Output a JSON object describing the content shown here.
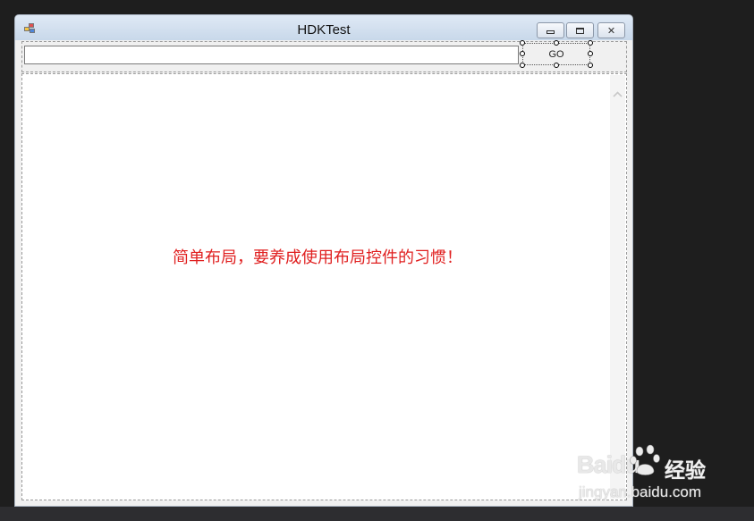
{
  "window": {
    "title": "HDKTest",
    "icon": "winforms-app-icon",
    "caption_buttons": [
      "minimize-icon",
      "maximize-icon",
      "close-icon"
    ]
  },
  "toolbar": {
    "url_value": "",
    "go_label": "GO"
  },
  "content": {
    "message": "简单布局，要养成使用布局控件的习惯！",
    "message_color": "#e02020"
  },
  "watermark": {
    "logo": "Baidu",
    "jingyan": "经验",
    "url": "jingyan.baidu.com"
  }
}
